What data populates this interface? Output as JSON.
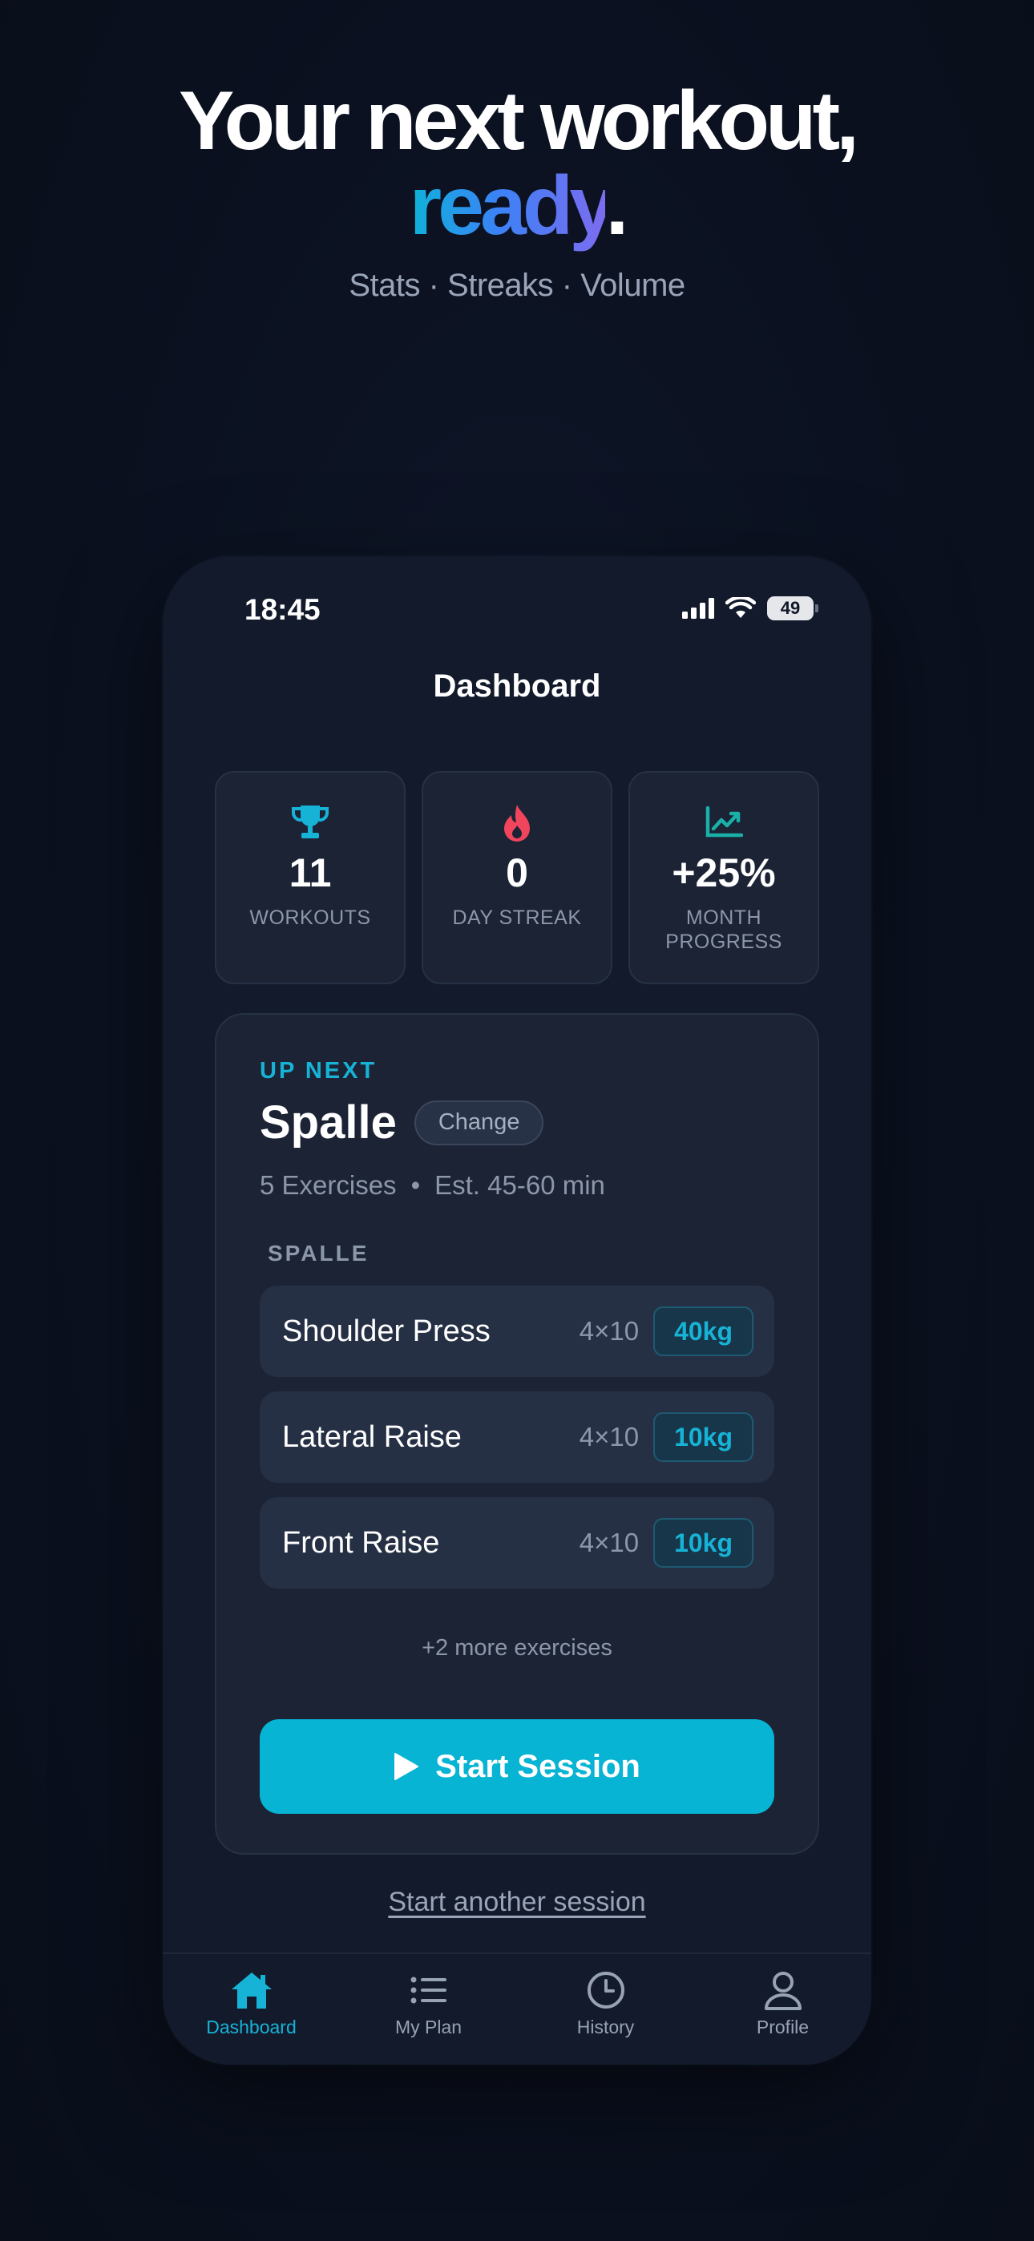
{
  "hero": {
    "title_line1": "Your next workout,",
    "title_accent": "ready",
    "title_period": ".",
    "subtitle": "Stats · Streaks · Volume"
  },
  "status_bar": {
    "time": "18:45",
    "battery": "49"
  },
  "nav": {
    "title": "Dashboard"
  },
  "stats": [
    {
      "value": "11",
      "label": "WORKOUTS",
      "icon": "trophy-icon",
      "color": "#17b3d6"
    },
    {
      "value": "0",
      "label": "DAY STREAK",
      "icon": "flame-icon",
      "color": "#f0455d"
    },
    {
      "value": "+25%",
      "label": "MONTH PROGRESS",
      "icon": "chart-line-icon",
      "color": "#1ab0a8"
    }
  ],
  "workout": {
    "eyebrow": "UP NEXT",
    "name": "Spalle",
    "change_label": "Change",
    "exercise_count": "5 Exercises",
    "separator": "•",
    "estimate": "Est. 45-60 min",
    "group_label": "SPALLE",
    "exercises": [
      {
        "name": "Shoulder Press",
        "sets": "4×10",
        "weight": "40kg"
      },
      {
        "name": "Lateral Raise",
        "sets": "4×10",
        "weight": "10kg"
      },
      {
        "name": "Front Raise",
        "sets": "4×10",
        "weight": "10kg"
      }
    ],
    "more_label": "+2 more exercises",
    "start_label": "Start Session"
  },
  "secondary_action": "Start another session",
  "tabs": [
    {
      "label": "Dashboard",
      "icon": "home-icon",
      "active": true
    },
    {
      "label": "My Plan",
      "icon": "list-icon",
      "active": false
    },
    {
      "label": "History",
      "icon": "clock-icon",
      "active": false
    },
    {
      "label": "Profile",
      "icon": "user-icon",
      "active": false
    }
  ],
  "colors": {
    "accent": "#08b4d4",
    "background": "#0b1120",
    "card": "#1b2335",
    "streak": "#f0455d"
  }
}
